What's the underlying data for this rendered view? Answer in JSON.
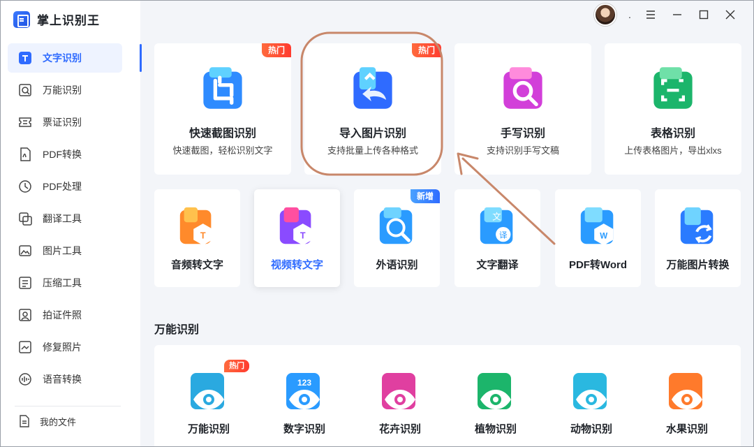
{
  "app": {
    "name": "掌上识别王"
  },
  "titlebar": {
    "more_dot": "."
  },
  "sidebar": {
    "items": [
      {
        "label": "文字识别",
        "icon": "text-recognition-icon",
        "active": true
      },
      {
        "label": "万能识别",
        "icon": "universal-scan-icon"
      },
      {
        "label": "票证识别",
        "icon": "ticket-icon"
      },
      {
        "label": "PDF转换",
        "icon": "pdf-convert-icon"
      },
      {
        "label": "PDF处理",
        "icon": "pdf-process-icon"
      },
      {
        "label": "翻译工具",
        "icon": "translate-icon"
      },
      {
        "label": "图片工具",
        "icon": "image-tool-icon"
      },
      {
        "label": "压缩工具",
        "icon": "compress-icon"
      },
      {
        "label": "拍证件照",
        "icon": "id-photo-icon"
      },
      {
        "label": "修复照片",
        "icon": "photo-repair-icon"
      },
      {
        "label": "语音转换",
        "icon": "voice-convert-icon"
      }
    ],
    "my_files": "我的文件"
  },
  "top_cards": [
    {
      "title": "快速截图识别",
      "desc": "快速截图，轻松识别文字",
      "badge": "热门",
      "icon": "screenshot-crop-icon",
      "color": "#2e8bff"
    },
    {
      "title": "导入图片识别",
      "desc": "支持批量上传各种格式",
      "badge": "热门",
      "icon": "import-image-icon",
      "color": "#2f6bff"
    },
    {
      "title": "手写识别",
      "desc": "支持识别手写文稿",
      "badge": "",
      "icon": "handwriting-icon",
      "color": "#d23fd9"
    },
    {
      "title": "表格识别",
      "desc": "上传表格图片，导出xlxs",
      "badge": "",
      "icon": "table-icon",
      "color": "#1cb56b"
    }
  ],
  "mid_cards": [
    {
      "title": "音频转文字",
      "badge": "",
      "icon": "audio-to-text-icon",
      "color": "#ff8a2b"
    },
    {
      "title": "视频转文字",
      "badge": "",
      "icon": "video-to-text-icon",
      "color": "#8a4bff",
      "selected": true
    },
    {
      "title": "外语识别",
      "badge": "新增",
      "icon": "foreign-language-icon",
      "color": "#2a9bff"
    },
    {
      "title": "文字翻译",
      "badge": "",
      "icon": "text-translate-icon",
      "color": "#2a9bff"
    },
    {
      "title": "PDF转Word",
      "badge": "",
      "icon": "pdf-to-word-icon",
      "color": "#2a9bff"
    },
    {
      "title": "万能图片转换",
      "badge": "",
      "icon": "image-convert-icon",
      "color": "#2a7bff"
    }
  ],
  "section": {
    "title": "万能识别"
  },
  "bottom_cards": [
    {
      "title": "万能识别",
      "badge": "热门",
      "icon": "universal-eye-icon",
      "color": "#2aa9e0"
    },
    {
      "title": "数字识别",
      "badge": "",
      "icon": "number-eye-icon",
      "color": "#2a9bff",
      "label": "123"
    },
    {
      "title": "花卉识别",
      "badge": "",
      "icon": "flower-eye-icon",
      "color": "#e03fa0"
    },
    {
      "title": "植物识别",
      "badge": "",
      "icon": "plant-eye-icon",
      "color": "#1cb56b"
    },
    {
      "title": "动物识别",
      "badge": "",
      "icon": "animal-eye-icon",
      "color": "#2ab8e0"
    },
    {
      "title": "水果识别",
      "badge": "",
      "icon": "fruit-eye-icon",
      "color": "#ff7a2b"
    }
  ],
  "colors": {
    "accent": "#2f6bff",
    "hot": "#ff3b2f",
    "annotation": "#c8876a"
  }
}
